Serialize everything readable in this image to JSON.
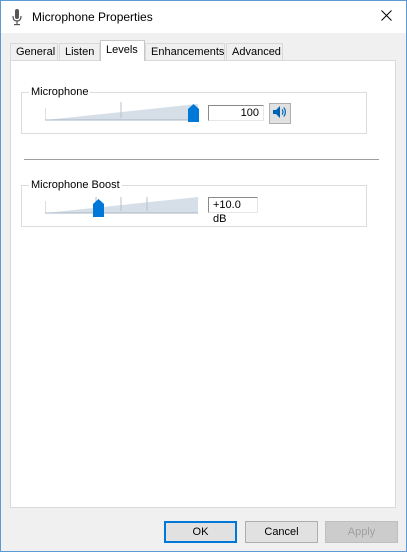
{
  "window": {
    "title": "Microphone Properties",
    "title_icon": "microphone-icon"
  },
  "titlebar": {
    "close_icon": "close-icon"
  },
  "tabs": [
    {
      "label": "General",
      "active": false
    },
    {
      "label": "Listen",
      "active": false
    },
    {
      "label": "Levels",
      "active": true
    },
    {
      "label": "Enhancements",
      "active": false
    },
    {
      "label": "Advanced",
      "active": false
    }
  ],
  "levels": {
    "microphone": {
      "label": "Microphone",
      "value": "100",
      "level_fraction": 1.0,
      "mute_icon": "speaker-icon"
    },
    "boost": {
      "label": "Microphone Boost",
      "value": "+10.0 dB",
      "level_fraction": 0.333
    }
  },
  "buttons": {
    "ok": "OK",
    "cancel": "Cancel",
    "apply": "Apply"
  },
  "colors": {
    "accent": "#0078d7",
    "ramp": "#d6dfe8",
    "disabled_text": "#a0a0a0"
  }
}
